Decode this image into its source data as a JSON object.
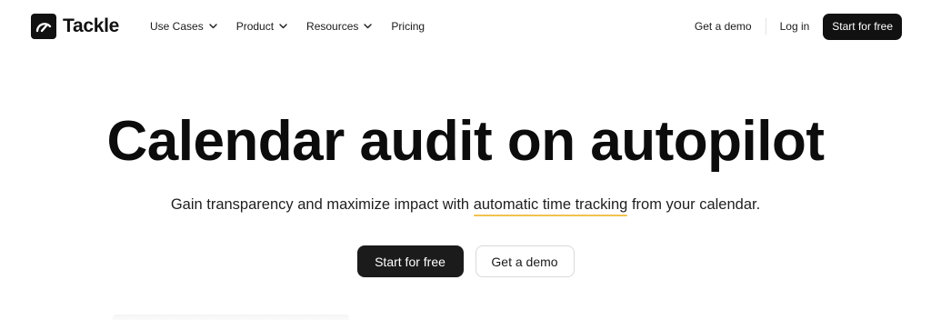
{
  "brand": {
    "name": "Tackle",
    "logo_icon": "gauge-icon"
  },
  "nav": {
    "items": [
      {
        "label": "Use Cases",
        "has_dropdown": true
      },
      {
        "label": "Product",
        "has_dropdown": true
      },
      {
        "label": "Resources",
        "has_dropdown": true
      },
      {
        "label": "Pricing",
        "has_dropdown": false
      }
    ],
    "demo_label": "Get a demo",
    "login_label": "Log in",
    "start_label": "Start for free"
  },
  "hero": {
    "title": "Calendar audit on autopilot",
    "subtitle_before": "Gain transparency and maximize impact with ",
    "subtitle_highlight": "automatic time tracking",
    "subtitle_after": " from your calendar.",
    "primary_cta": "Start for free",
    "secondary_cta": "Get a demo"
  },
  "colors": {
    "primary": "#111111",
    "highlight_underline": "#f2c14e",
    "background": "#ffffff"
  }
}
